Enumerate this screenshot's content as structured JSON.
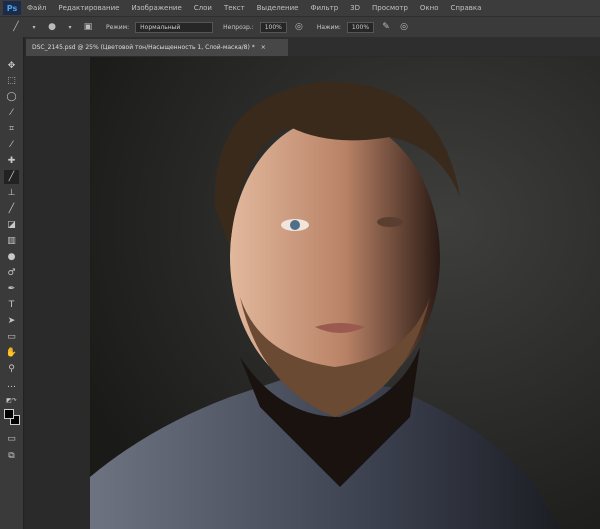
{
  "app": {
    "logo": "Ps"
  },
  "menu": [
    "Файл",
    "Редактирование",
    "Изображение",
    "Слои",
    "Текст",
    "Выделение",
    "Фильтр",
    "3D",
    "Просмотр",
    "Окно",
    "Справка"
  ],
  "options": {
    "mode_label": "Режим:",
    "mode_value": "Нормальный",
    "opacity_label": "Непрозр.:",
    "opacity_value": "100%",
    "flow_label": "Нажим:",
    "flow_value": "100%"
  },
  "document_tab": {
    "title": "DSC_2145.psd @ 25% (Цветовой тон/Насыщенность 1, Слой-маска/8) *",
    "close": "×"
  },
  "tools": [
    "move",
    "marquee",
    "lasso",
    "quick-select",
    "crop",
    "eyedropper",
    "healing",
    "brush",
    "stamp",
    "history-brush",
    "eraser",
    "gradient",
    "blur",
    "dodge",
    "pen",
    "type",
    "path-select",
    "rectangle",
    "hand",
    "zoom",
    "more",
    "swap-colors",
    "colors",
    "quick-mask",
    "screen-mode"
  ],
  "colors": {
    "foreground": "#000000",
    "background": "#000000"
  }
}
